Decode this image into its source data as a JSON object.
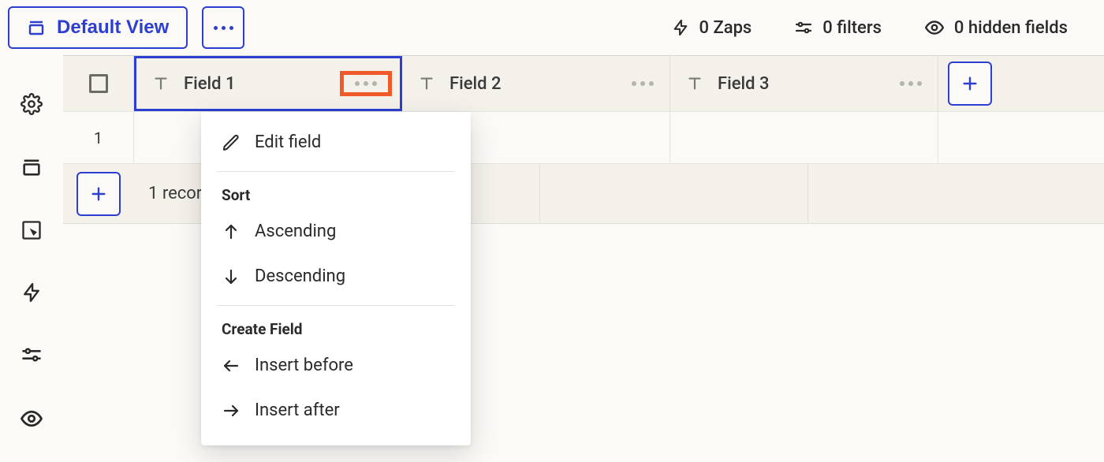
{
  "topbar": {
    "view_label": "Default View",
    "stats": {
      "zaps": "0 Zaps",
      "filters": "0 filters",
      "hidden": "0 hidden fields"
    }
  },
  "columns": [
    {
      "label": "Field 1",
      "selected": true
    },
    {
      "label": "Field 2",
      "selected": false
    },
    {
      "label": "Field 3",
      "selected": false
    }
  ],
  "rows": [
    {
      "num": "1"
    }
  ],
  "footer": {
    "record_count": "1 record"
  },
  "dropdown": {
    "edit": "Edit field",
    "sort_heading": "Sort",
    "ascending": "Ascending",
    "descending": "Descending",
    "create_heading": "Create Field",
    "insert_before": "Insert before",
    "insert_after": "Insert after"
  }
}
